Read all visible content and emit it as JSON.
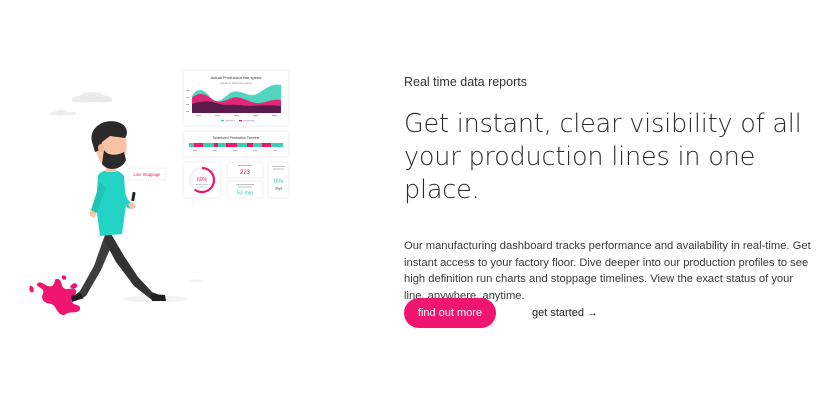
{
  "hero": {
    "eyebrow": "Real time data reports",
    "headline_line1": "Get instant, clear visibility of all",
    "headline_line2": "your production lines in one place.",
    "body": "Our manufacturing dashboard tracks performance and availability in real-time. Get instant access to your factory floor. Dive deeper into our production profiles to see high definition run charts and stoppage timelines. View the exact status of your line, anywhere, anytime.",
    "primary_button": "find out more",
    "secondary_link": "get started →"
  },
  "illustration": {
    "line_stoppage_label": "Line Stoppage",
    "chart_title": "Actual Production line speed",
    "chart_subtitle": "Actual vs Target line speed",
    "timeline_title": "Scheduled Production Timeline",
    "gauge_value": "60%",
    "stat_value_1": "223",
    "stat_value_2": "53 min",
    "stat_value_3": "0%",
    "stat_unit_3": "days",
    "colors": {
      "magenta": "#f0156e",
      "teal": "#35d0b5",
      "purple": "#5a1d4b",
      "shirt": "#23d3c5",
      "pants": "#3a3a3a"
    }
  }
}
